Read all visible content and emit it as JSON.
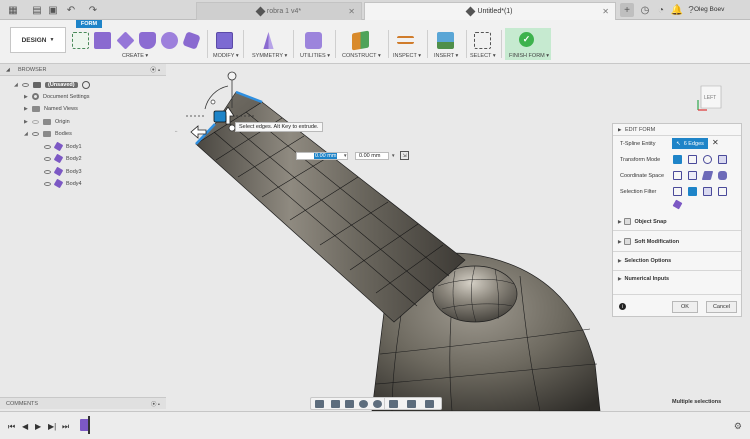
{
  "tabs": {
    "inactive_title": "robra 1 v4*",
    "active_title": "Untitled*(1)"
  },
  "user": {
    "name": "Oleg Boev"
  },
  "toolbar": {
    "workspace_tab": "FORM",
    "workspace_switch": "DESIGN",
    "groups": {
      "create": "CREATE",
      "modify": "MODIFY",
      "symmetry": "SYMMETRY",
      "utilities": "UTILITIES",
      "construct": "CONSTRUCT",
      "inspect": "INSPECT",
      "insert": "INSERT",
      "select": "SELECT",
      "finish": "FINISH FORM"
    },
    "finish_color": "#3db24d"
  },
  "browser": {
    "title": "BROWSER",
    "root": "(Unsaved)",
    "items": {
      "document_settings": "Document Settings",
      "named_views": "Named Views",
      "origin": "Origin",
      "bodies": "Bodies",
      "body1": "Body1",
      "body2": "Body2",
      "body3": "Body3",
      "body4": "Body4"
    }
  },
  "viewport": {
    "tooltip": "Select edges. Alt Key to extrude.",
    "dist_value_1": "0.00 mm",
    "dist_value_2": "0.00 mm",
    "viewcube_face": "LEFT",
    "status": "Multiple selections"
  },
  "edit_form": {
    "title": "EDIT FORM",
    "tspline_entity_label": "T-Spline Entity",
    "tspline_entity_value": "6 Edges",
    "transform_mode_label": "Transform Mode",
    "coordinate_space_label": "Coordinate Space",
    "selection_filter_label": "Selection Filter",
    "object_snap": "Object Snap",
    "soft_modification": "Soft Modification",
    "selection_options": "Selection Options",
    "numerical_inputs": "Numerical Inputs",
    "ok": "OK",
    "cancel": "Cancel",
    "accent": "#1e84c8"
  },
  "comments": {
    "title": "COMMENTS"
  }
}
